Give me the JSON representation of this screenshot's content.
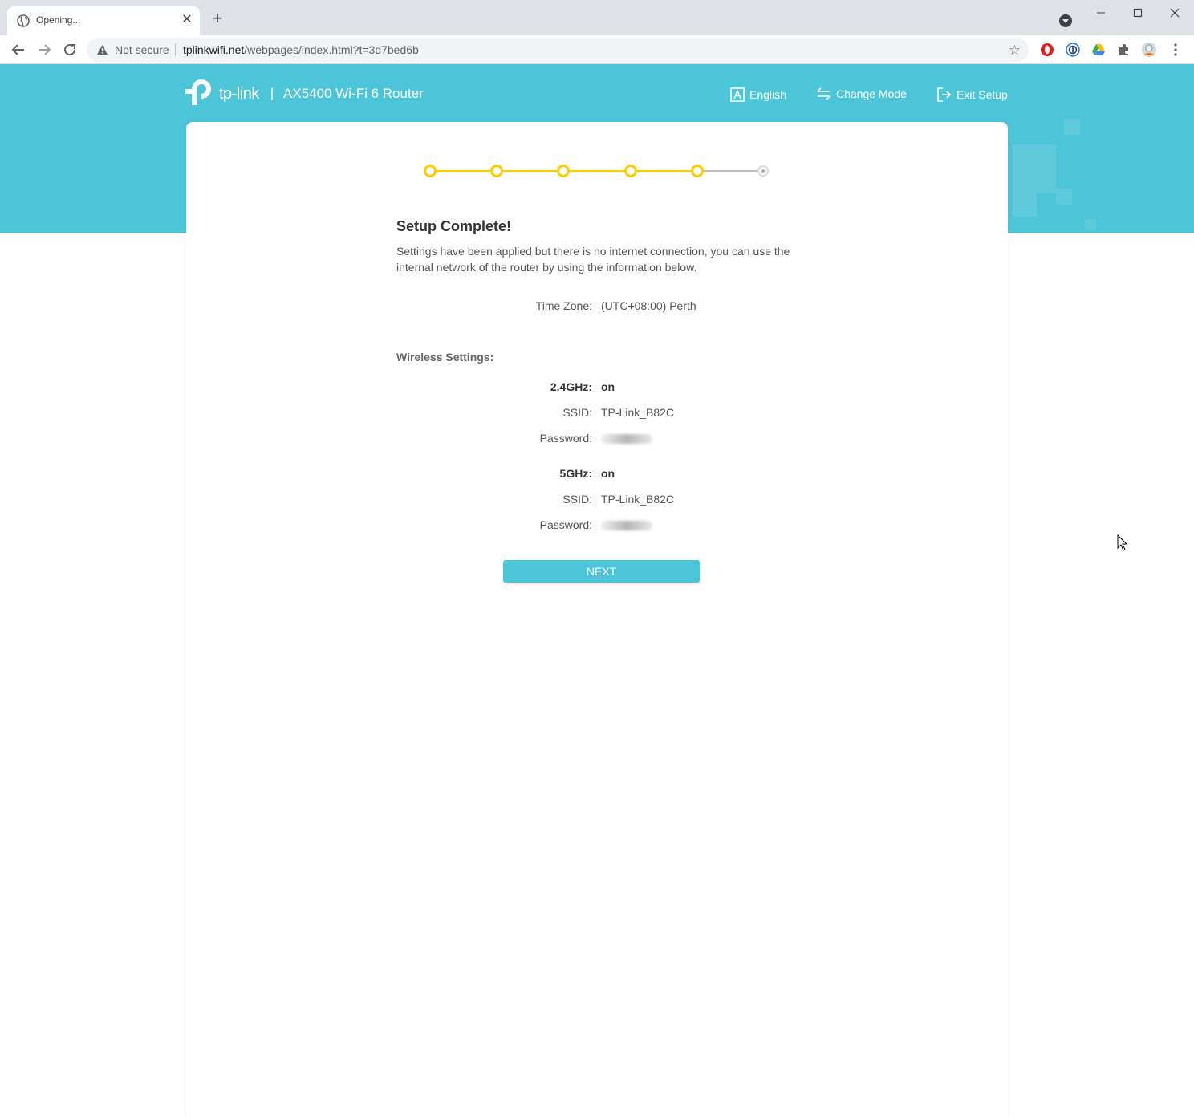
{
  "browser": {
    "tab_title": "Opening...",
    "not_secure_label": "Not secure",
    "url_host": "tplinkwifi.net",
    "url_path": "/webpages/index.html?t=3d7bed6b"
  },
  "header": {
    "logo_text": "tp-link",
    "separator": "|",
    "product_name": "AX5400 Wi-Fi 6 Router",
    "language_label": "English",
    "change_mode_label": "Change Mode",
    "exit_setup_label": "Exit Setup"
  },
  "stepper": {
    "total_steps": 6,
    "completed_steps": 5
  },
  "main": {
    "title": "Setup Complete!",
    "description": "Settings have been applied but there is no internet connection, you can use the internal network of the router by using the information below.",
    "time_zone_label": "Time Zone:",
    "time_zone_value": "(UTC+08:00) Perth",
    "wireless_label": "Wireless Settings:",
    "band_24": {
      "label": "2.4GHz:",
      "status": "on",
      "ssid_label": "SSID:",
      "ssid": "TP-Link_B82C",
      "password_label": "Password:"
    },
    "band_5": {
      "label": "5GHz:",
      "status": "on",
      "ssid_label": "SSID:",
      "ssid": "TP-Link_B82C",
      "password_label": "Password:"
    },
    "next_label": "NEXT"
  },
  "colors": {
    "brand_teal": "#4dc5d8",
    "step_active": "#ffcc00",
    "step_inactive": "#d9d9d9"
  }
}
